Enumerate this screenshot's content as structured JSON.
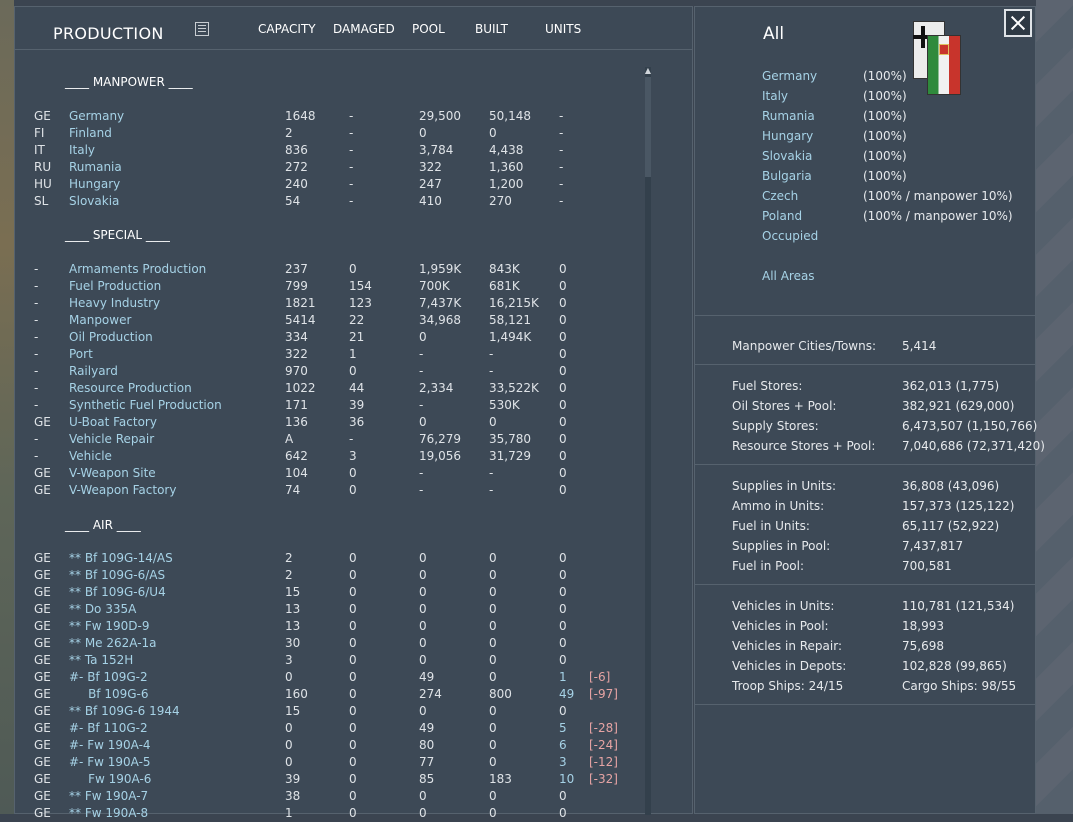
{
  "header": {
    "title": "PRODUCTION",
    "columns": {
      "capacity": "CAPACITY",
      "damaged": "DAMAGED",
      "pool": "POOL",
      "built": "BUILT",
      "units": "UNITS"
    }
  },
  "sections": {
    "manpower": "____ MANPOWER ____",
    "special": "____ SPECIAL ____",
    "air": "____ AIR ____"
  },
  "manpower_rows": [
    {
      "code": "GE",
      "name": "Germany",
      "capacity": "1648",
      "damaged": "-",
      "pool": "29,500",
      "built": "50,148",
      "units": "-"
    },
    {
      "code": "FI",
      "name": "Finland",
      "capacity": "2",
      "damaged": "-",
      "pool": "0",
      "built": "0",
      "units": "-"
    },
    {
      "code": "IT",
      "name": "Italy",
      "capacity": "836",
      "damaged": "-",
      "pool": "3,784",
      "built": "4,438",
      "units": "-"
    },
    {
      "code": "RU",
      "name": "Rumania",
      "capacity": "272",
      "damaged": "-",
      "pool": "322",
      "built": "1,360",
      "units": "-"
    },
    {
      "code": "HU",
      "name": "Hungary",
      "capacity": "240",
      "damaged": "-",
      "pool": "247",
      "built": "1,200",
      "units": "-"
    },
    {
      "code": "SL",
      "name": "Slovakia",
      "capacity": "54",
      "damaged": "-",
      "pool": "410",
      "built": "270",
      "units": "-"
    }
  ],
  "special_rows": [
    {
      "code": "-",
      "name": "Armaments Production",
      "capacity": "237",
      "damaged": "0",
      "pool": "1,959K",
      "built": "843K",
      "units": "0"
    },
    {
      "code": "-",
      "name": "Fuel Production",
      "capacity": "799",
      "damaged": "154",
      "pool": "700K",
      "built": "681K",
      "units": "0"
    },
    {
      "code": "-",
      "name": "Heavy Industry",
      "capacity": "1821",
      "damaged": "123",
      "pool": "7,437K",
      "built": "16,215K",
      "units": "0"
    },
    {
      "code": "-",
      "name": "Manpower",
      "capacity": "5414",
      "damaged": "22",
      "pool": "34,968",
      "built": "58,121",
      "units": "0"
    },
    {
      "code": "-",
      "name": "Oil Production",
      "capacity": "334",
      "damaged": "21",
      "pool": "0",
      "built": "1,494K",
      "units": "0"
    },
    {
      "code": "-",
      "name": "Port",
      "capacity": "322",
      "damaged": "1",
      "pool": "-",
      "built": "-",
      "units": "0"
    },
    {
      "code": "-",
      "name": "Railyard",
      "capacity": "970",
      "damaged": "0",
      "pool": "-",
      "built": "-",
      "units": "0"
    },
    {
      "code": "-",
      "name": "Resource Production",
      "capacity": "1022",
      "damaged": "44",
      "pool": "2,334",
      "built": "33,522K",
      "units": "0"
    },
    {
      "code": "-",
      "name": "Synthetic Fuel Production",
      "capacity": "171",
      "damaged": "39",
      "pool": "-",
      "built": "530K",
      "units": "0"
    },
    {
      "code": "GE",
      "name": "U-Boat Factory",
      "capacity": "136",
      "damaged": "36",
      "pool": "0",
      "built": "0",
      "units": "0"
    },
    {
      "code": "-",
      "name": "Vehicle Repair",
      "capacity": "A",
      "damaged": "-",
      "pool": "76,279",
      "built": "35,780",
      "units": "0"
    },
    {
      "code": "-",
      "name": "Vehicle",
      "capacity": "642",
      "damaged": "3",
      "pool": "19,056",
      "built": "31,729",
      "units": "0"
    },
    {
      "code": "GE",
      "name": "V-Weapon Site",
      "capacity": "104",
      "damaged": "0",
      "pool": "-",
      "built": "-",
      "units": "0"
    },
    {
      "code": "GE",
      "name": "V-Weapon Factory",
      "capacity": "74",
      "damaged": "0",
      "pool": "-",
      "built": "-",
      "units": "0"
    }
  ],
  "air_rows": [
    {
      "code": "GE",
      "name": "** Bf 109G-14/AS",
      "capacity": "2",
      "damaged": "0",
      "pool": "0",
      "built": "0",
      "units": "0",
      "delta": ""
    },
    {
      "code": "GE",
      "name": "** Bf 109G-6/AS",
      "capacity": "2",
      "damaged": "0",
      "pool": "0",
      "built": "0",
      "units": "0",
      "delta": ""
    },
    {
      "code": "GE",
      "name": "** Bf 109G-6/U4",
      "capacity": "15",
      "damaged": "0",
      "pool": "0",
      "built": "0",
      "units": "0",
      "delta": ""
    },
    {
      "code": "GE",
      "name": "** Do 335A",
      "capacity": "13",
      "damaged": "0",
      "pool": "0",
      "built": "0",
      "units": "0",
      "delta": ""
    },
    {
      "code": "GE",
      "name": "** Fw 190D-9",
      "capacity": "13",
      "damaged": "0",
      "pool": "0",
      "built": "0",
      "units": "0",
      "delta": ""
    },
    {
      "code": "GE",
      "name": "** Me 262A-1a",
      "capacity": "30",
      "damaged": "0",
      "pool": "0",
      "built": "0",
      "units": "0",
      "delta": ""
    },
    {
      "code": "GE",
      "name": "** Ta 152H",
      "capacity": "3",
      "damaged": "0",
      "pool": "0",
      "built": "0",
      "units": "0",
      "delta": ""
    },
    {
      "code": "GE",
      "name": "#- Bf 109G-2",
      "capacity": "0",
      "damaged": "0",
      "pool": "49",
      "built": "0",
      "units": "1",
      "delta": "[-6]"
    },
    {
      "code": "GE",
      "name": "     Bf 109G-6",
      "capacity": "160",
      "damaged": "0",
      "pool": "274",
      "built": "800",
      "units": "49",
      "delta": "[-97]"
    },
    {
      "code": "GE",
      "name": "** Bf 109G-6 1944",
      "capacity": "15",
      "damaged": "0",
      "pool": "0",
      "built": "0",
      "units": "0",
      "delta": ""
    },
    {
      "code": "GE",
      "name": "#- Bf 110G-2",
      "capacity": "0",
      "damaged": "0",
      "pool": "49",
      "built": "0",
      "units": "5",
      "delta": "[-28]"
    },
    {
      "code": "GE",
      "name": "#- Fw 190A-4",
      "capacity": "0",
      "damaged": "0",
      "pool": "80",
      "built": "0",
      "units": "6",
      "delta": "[-24]"
    },
    {
      "code": "GE",
      "name": "#- Fw 190A-5",
      "capacity": "0",
      "damaged": "0",
      "pool": "77",
      "built": "0",
      "units": "3",
      "delta": "[-12]"
    },
    {
      "code": "GE",
      "name": "     Fw 190A-6",
      "capacity": "39",
      "damaged": "0",
      "pool": "85",
      "built": "183",
      "units": "10",
      "delta": "[-32]"
    },
    {
      "code": "GE",
      "name": "** Fw 190A-7",
      "capacity": "38",
      "damaged": "0",
      "pool": "0",
      "built": "0",
      "units": "0",
      "delta": ""
    },
    {
      "code": "GE",
      "name": "** Fw 190A-8",
      "capacity": "1",
      "damaged": "0",
      "pool": "0",
      "built": "0",
      "units": "0",
      "delta": ""
    }
  ],
  "right_panel": {
    "title": "All",
    "nations": [
      {
        "name": "Germany",
        "pct": "(100%)"
      },
      {
        "name": "Italy",
        "pct": "(100%)"
      },
      {
        "name": "Rumania",
        "pct": "(100%)"
      },
      {
        "name": "Hungary",
        "pct": "(100%)"
      },
      {
        "name": "Slovakia",
        "pct": "(100%)"
      },
      {
        "name": "Bulgaria",
        "pct": "(100%)"
      },
      {
        "name": "Czech",
        "pct": "(100% / manpower 10%)"
      },
      {
        "name": "Poland",
        "pct": "(100% / manpower 10%)"
      },
      {
        "name": "Occupied",
        "pct": ""
      }
    ],
    "all_areas": "All Areas",
    "manpower_cities": {
      "label": "Manpower Cities/Towns:",
      "value": "5,414"
    },
    "stores": [
      {
        "label": "Fuel Stores:",
        "value": "362,013 (1,775)"
      },
      {
        "label": "Oil Stores + Pool:",
        "value": "382,921 (629,000)"
      },
      {
        "label": "Supply Stores:",
        "value": "6,473,507 (1,150,766)"
      },
      {
        "label": "Resource Stores + Pool:",
        "value": "7,040,686 (72,371,420)"
      }
    ],
    "supplies": [
      {
        "label": "Supplies in Units:",
        "value": "36,808 (43,096)"
      },
      {
        "label": "Ammo in Units:",
        "value": "157,373 (125,122)"
      },
      {
        "label": "Fuel in Units:",
        "value": "65,117 (52,922)"
      },
      {
        "label": "Supplies in Pool:",
        "value": "7,437,817"
      },
      {
        "label": "Fuel in Pool:",
        "value": "700,581"
      }
    ],
    "vehicles": [
      {
        "label": "Vehicles in Units:",
        "value": "110,781 (121,534)"
      },
      {
        "label": "Vehicles in Pool:",
        "value": "18,993"
      },
      {
        "label": "Vehicles in Repair:",
        "value": "75,698"
      },
      {
        "label": "Vehicles in Depots:",
        "value": "102,828 (99,865)"
      }
    ],
    "ships": {
      "troop": "Troop Ships: 24/15",
      "cargo": "Cargo Ships: 98/55"
    }
  }
}
